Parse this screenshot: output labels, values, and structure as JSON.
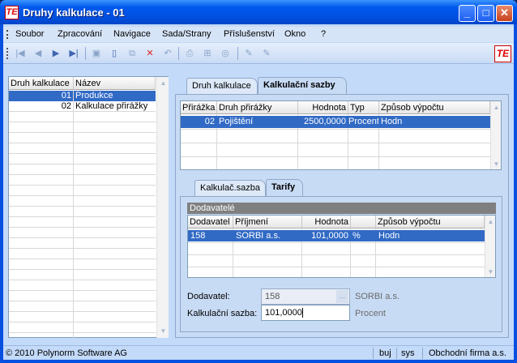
{
  "window": {
    "title": "Druhy kalkulace - 01",
    "logo_text": "TE",
    "min_label": "_",
    "max_label": "□",
    "close_label": "✕"
  },
  "menu": [
    "Soubor",
    "Zpracování",
    "Navigace",
    "Sada/Strany",
    "Příslušenství",
    "Okno",
    "?"
  ],
  "toolbar": {
    "icons": [
      "first-record-icon",
      "previous-record-icon",
      "next-record-icon",
      "last-record-icon",
      "save-icon",
      "new-record-icon",
      "copy-icon",
      "delete-icon",
      "undo-icon",
      "print-icon",
      "structure-icon",
      "search-icon",
      "edit-icon",
      "edit-disabled-icon"
    ],
    "glyphs": [
      "|◀",
      "◀",
      "▶",
      "▶|",
      "▣",
      "▯",
      "⧉",
      "✕",
      "↶",
      "⎙",
      "⊞",
      "◎",
      "✎",
      "✎"
    ]
  },
  "left_grid": {
    "columns": [
      "Druh kalkulace",
      "Název"
    ],
    "rows": [
      {
        "code": "01",
        "name": "Produkce",
        "selected": true
      },
      {
        "code": "02",
        "name": "Kalkulace přirážky",
        "selected": false
      }
    ]
  },
  "top_tabs": [
    "Druh kalkulace",
    "Kalkulační sazby"
  ],
  "top_tabs_active": 1,
  "rates_grid": {
    "columns": [
      "Přirážka",
      "Druh přirážky",
      "Hodnota",
      "Typ",
      "Způsob výpočtu"
    ],
    "rows": [
      {
        "prirazka": "02",
        "druh": "Pojištění",
        "hodnota": "2500,0000",
        "typ": "Procent",
        "zpusob": "Hodn"
      }
    ]
  },
  "sub_tabs": [
    "Kalkulač.sazba",
    "Tarify"
  ],
  "sub_tabs_active": 1,
  "suppliers": {
    "group_title": "Dodavatelé",
    "columns": [
      "Dodavatel",
      "Příjmení",
      "Hodnota",
      "",
      "Způsob výpočtu"
    ],
    "rows": [
      {
        "dodavatel": "158",
        "prijmeni": "SORBI a.s.",
        "hodnota": "101,0000",
        "unit": "%",
        "zpusob": "Hodn"
      }
    ]
  },
  "form": {
    "supplier_label": "Dodavatel:",
    "supplier_value": "158",
    "supplier_lookup": "...",
    "supplier_name": "SORBI a.s.",
    "rate_label": "Kalkulační sazba:",
    "rate_value": "101,0000",
    "rate_unit": "Procent"
  },
  "status": {
    "copyright": "© 2010 Polynorm Software AG",
    "cells": [
      "buj",
      "sys",
      "Obchodní firma a.s."
    ]
  },
  "colors": {
    "selection": "#316ac5",
    "titlebar": "#0058ee",
    "panel": "#c8dbf5"
  }
}
